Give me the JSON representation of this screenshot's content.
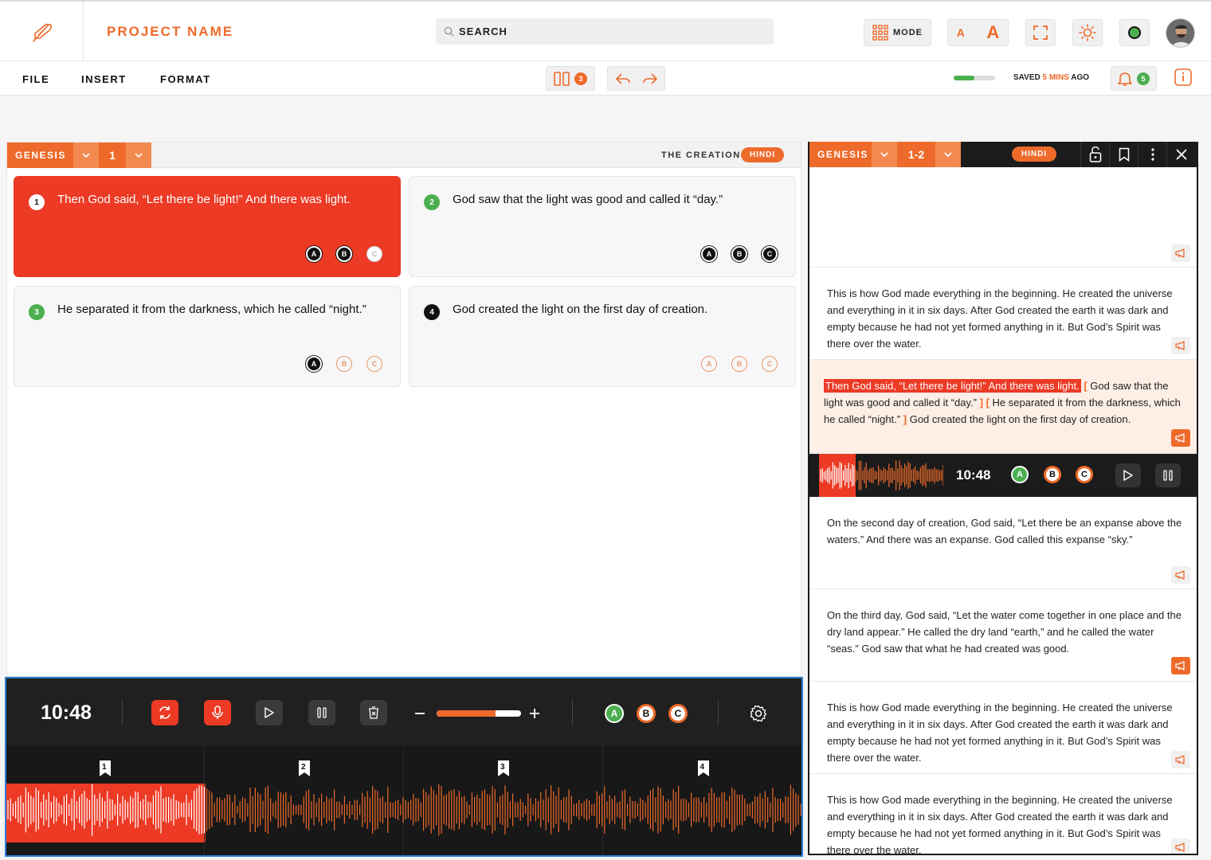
{
  "header": {
    "project_name": "PROJECT NAME",
    "search_placeholder": "SEARCH",
    "mode_label": "MODE",
    "font_small": "A",
    "font_large": "A"
  },
  "menu": {
    "items": [
      "FILE",
      "INSERT",
      "FORMAT"
    ],
    "columns_badge": "3",
    "saved_prefix": "SAVED",
    "saved_time": "5 MINS",
    "saved_suffix": "AGO",
    "notifications_badge": "5",
    "save_progress": 0.5
  },
  "left_panel": {
    "book": "GENESIS",
    "chapter": "1",
    "title": "THE CREATION",
    "language": "HINDI",
    "cards": [
      {
        "num": "1",
        "text": "Then God said, “Let there be light!” And there was light.",
        "dots": [
          "A",
          "B",
          "C"
        ]
      },
      {
        "num": "2",
        "text": "God saw that the light was good and called it “day.”",
        "dots": [
          "A",
          "B",
          "C"
        ]
      },
      {
        "num": "3",
        "text": "He separated it from the darkness, which he called “night.”",
        "dots": [
          "A",
          "B",
          "C"
        ]
      },
      {
        "num": "4",
        "text": "God created the light on the first day of creation.",
        "dots": [
          "A",
          "B",
          "C"
        ]
      }
    ]
  },
  "player": {
    "time": "10:48",
    "volume": 0.7,
    "takes": [
      "A",
      "B",
      "C"
    ],
    "segments": [
      "1",
      "2",
      "3",
      "4"
    ]
  },
  "right_panel": {
    "book": "GENESIS",
    "chapter": "1-2",
    "language": "HINDI",
    "block1": "This is how God made everything in the beginning. He created the universe and everything in it in six days. After God created the earth it was dark and empty because he had not yet formed anything in it. But God’s Spirit was there over the water.",
    "hl_verse1": "Then God said, “Let there be light!” And there was light.",
    "hl_verse2": "God saw that the light was good and called it “day.”",
    "hl_verse3": "He separated it from the darkness, which he called “night.”",
    "hl_verse4": "God created the light on the first day of creation.",
    "bracket_open": "[",
    "bracket_close": "]",
    "player_time": "10:48",
    "takes": [
      "A",
      "B",
      "C"
    ],
    "block3": "On the second day of creation, God said, “Let there be an expanse above the waters.” And there was an expanse. God called this expanse “sky.”",
    "block4": "On the third day, God said, “Let the water come together in one place and the dry land appear.” He called the dry land “earth,” and he called the water “seas.” God saw that what he had created was good.",
    "block5": "This is how God made everything in the beginning. He created the universe and everything in it in six days. After God created the earth it was dark and empty because he had not yet formed anything in it. But God’s Spirit was there over the water.",
    "block6": "This is how God made everything in the beginning. He created the universe and everything in it in six days. After God created the earth it was dark and empty because he had not yet formed anything in it. But God’s Spirit was there over the water."
  },
  "colors": {
    "accent": "#ee6a2a",
    "active_red": "#ec3a25",
    "success": "#4caf50",
    "dark": "#1b1b1b"
  }
}
